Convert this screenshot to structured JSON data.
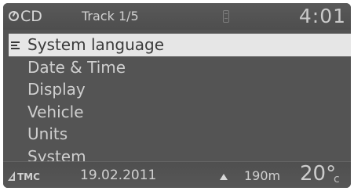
{
  "status_bar": {
    "source_icon": "disc-icon",
    "source": "CD",
    "track": "Track 1/5",
    "phone_icon": "phone-icon",
    "clock": "4:01"
  },
  "menu": {
    "selected_icon": "settings-icon",
    "items": [
      {
        "label": "System language",
        "selected": true
      },
      {
        "label": "Date & Time",
        "selected": false
      },
      {
        "label": "Display",
        "selected": false
      },
      {
        "label": "Vehicle",
        "selected": false
      },
      {
        "label": "Units",
        "selected": false
      },
      {
        "label": "System",
        "selected": false
      }
    ]
  },
  "bottom_bar": {
    "tmc_icon": "road-icon",
    "tmc": "TMC",
    "date": "19.02.2011",
    "nav_icon": "nav-arrow-icon",
    "distance": "190m",
    "temperature": "20°",
    "temperature_unit": "c"
  },
  "colors": {
    "background": "#545454",
    "highlight": "#e6e6e6",
    "text": "#d0d0d0",
    "highlight_text": "#3a3a3a"
  }
}
